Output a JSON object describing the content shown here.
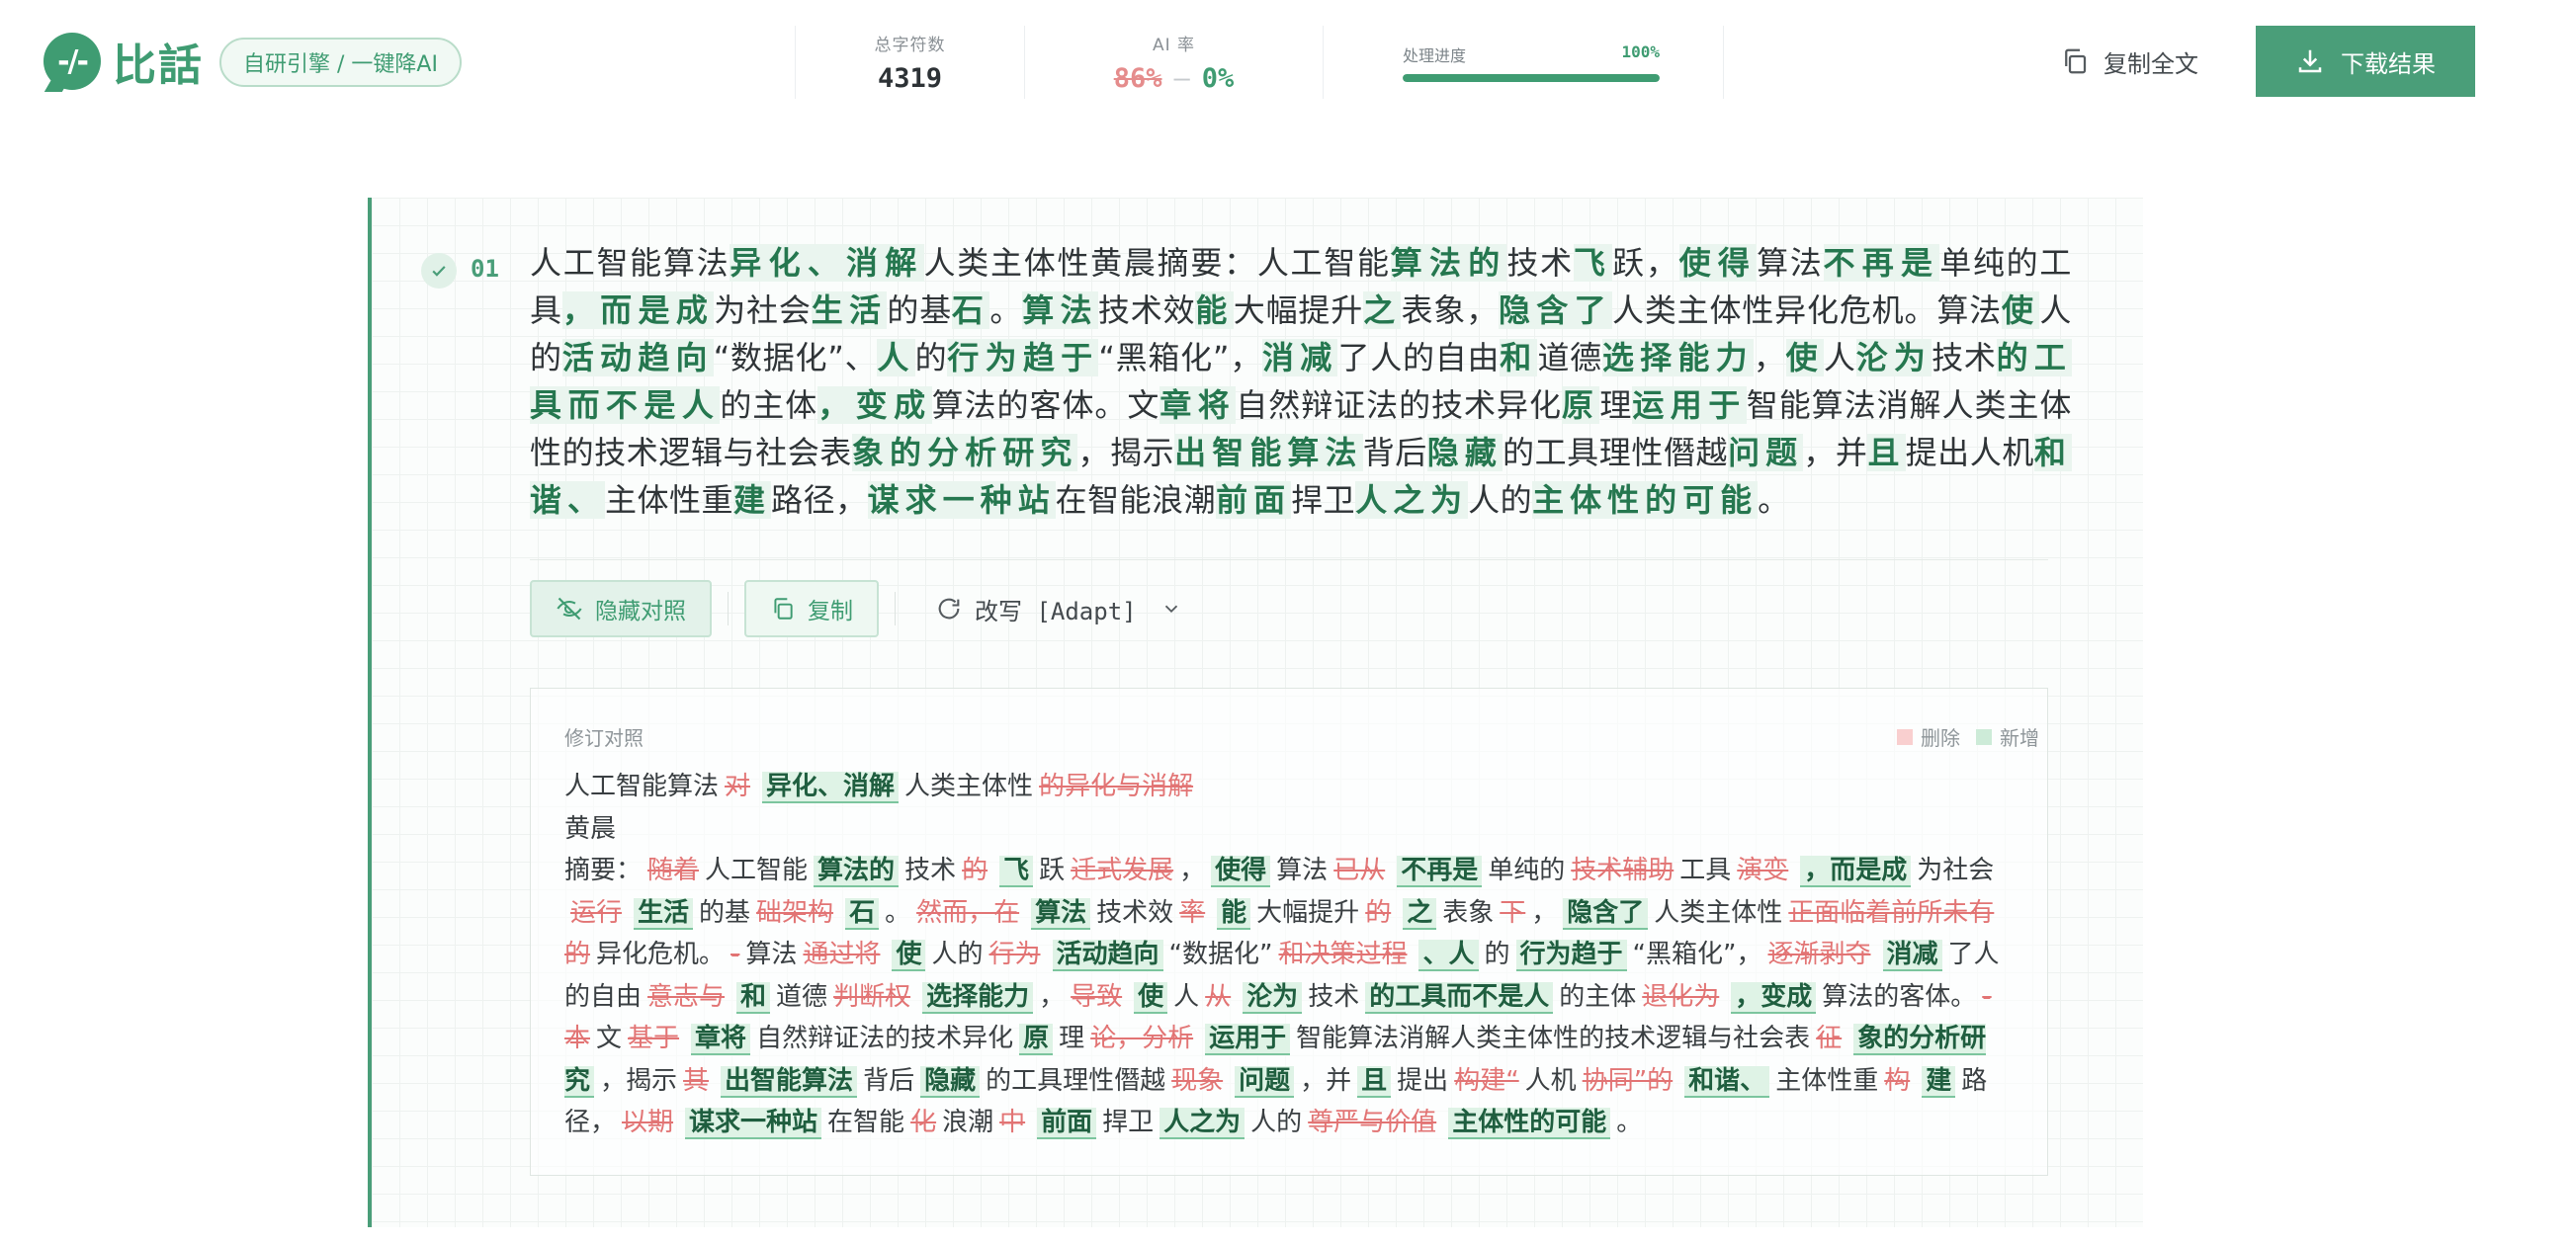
{
  "header": {
    "logo_mark": "-/-",
    "logo_text": "比話",
    "engine_label": "自研引擎 / 一键降AI",
    "stats": {
      "chars_label": "总字符数",
      "chars_value": "4319",
      "ai_label": "AI 率",
      "ai_before": "86%",
      "ai_separator": "—",
      "ai_after": "0%",
      "progress_label": "处理进度",
      "progress_pct_text": "100%",
      "progress_value": 100
    },
    "copy_all_label": "复制全文",
    "download_label": "下载结果",
    "accent_color": "#4a9e79"
  },
  "section": {
    "number": "01",
    "paragraph": [
      {
        "t": "人工智能算法",
        "h": false
      },
      {
        "t": "异化、消解",
        "h": true
      },
      {
        "t": "人类主体性黄晨摘要：人工智能",
        "h": false
      },
      {
        "t": "算法的",
        "h": true
      },
      {
        "t": "技术",
        "h": false
      },
      {
        "t": "飞",
        "h": true
      },
      {
        "t": "跃，",
        "h": false
      },
      {
        "t": "使得",
        "h": true
      },
      {
        "t": "算法",
        "h": false
      },
      {
        "t": "不再是",
        "h": true
      },
      {
        "t": "单纯的工具",
        "h": false
      },
      {
        "t": "，而是成",
        "h": true
      },
      {
        "t": "为社会",
        "h": false
      },
      {
        "t": "生活",
        "h": true
      },
      {
        "t": "的基",
        "h": false
      },
      {
        "t": "石",
        "h": true
      },
      {
        "t": "。",
        "h": false
      },
      {
        "t": "算法",
        "h": true
      },
      {
        "t": "技术效",
        "h": false
      },
      {
        "t": "能",
        "h": true
      },
      {
        "t": "大幅提升",
        "h": false
      },
      {
        "t": "之",
        "h": true
      },
      {
        "t": "表象，",
        "h": false
      },
      {
        "t": "隐含了",
        "h": true
      },
      {
        "t": "人类主体性异化危机。算法",
        "h": false
      },
      {
        "t": "使",
        "h": true
      },
      {
        "t": "人的",
        "h": false
      },
      {
        "t": "活动趋向",
        "h": true
      },
      {
        "t": "“数据化”、",
        "h": false
      },
      {
        "t": "人",
        "h": true
      },
      {
        "t": "的",
        "h": false
      },
      {
        "t": "行为趋于",
        "h": true
      },
      {
        "t": "“黑箱化”，",
        "h": false
      },
      {
        "t": "消减",
        "h": true
      },
      {
        "t": "了人的自由",
        "h": false
      },
      {
        "t": "和",
        "h": true
      },
      {
        "t": "道德",
        "h": false
      },
      {
        "t": "选择能力",
        "h": true
      },
      {
        "t": "，",
        "h": false
      },
      {
        "t": "使",
        "h": true
      },
      {
        "t": "人",
        "h": false
      },
      {
        "t": "沦为",
        "h": true
      },
      {
        "t": "技术",
        "h": false
      },
      {
        "t": "的工具而不是人",
        "h": true
      },
      {
        "t": "的主体",
        "h": false
      },
      {
        "t": "，变成",
        "h": true
      },
      {
        "t": "算法的客体。文",
        "h": false
      },
      {
        "t": "章将",
        "h": true
      },
      {
        "t": "自然辩证法的技术异化",
        "h": false
      },
      {
        "t": "原",
        "h": true
      },
      {
        "t": "理",
        "h": false
      },
      {
        "t": "运用于",
        "h": true
      },
      {
        "t": "智能算法消解人类主体性的技术逻辑与社会表",
        "h": false
      },
      {
        "t": "象的分析研究",
        "h": true
      },
      {
        "t": "，揭示",
        "h": false
      },
      {
        "t": "出智能算法",
        "h": true
      },
      {
        "t": "背后",
        "h": false
      },
      {
        "t": "隐藏",
        "h": true
      },
      {
        "t": "的工具理性僭越",
        "h": false
      },
      {
        "t": "问题",
        "h": true
      },
      {
        "t": "，并",
        "h": false
      },
      {
        "t": "且",
        "h": true
      },
      {
        "t": "提出人机",
        "h": false
      },
      {
        "t": "和谐、",
        "h": true
      },
      {
        "t": "主体性重",
        "h": false
      },
      {
        "t": "建",
        "h": true
      },
      {
        "t": "路径，",
        "h": false
      },
      {
        "t": "谋求一种站",
        "h": true
      },
      {
        "t": "在智能浪潮",
        "h": false
      },
      {
        "t": "前面",
        "h": true
      },
      {
        "t": "捍卫",
        "h": false
      },
      {
        "t": "人之为",
        "h": true
      },
      {
        "t": "人的",
        "h": false
      },
      {
        "t": "主体性的可能",
        "h": true
      },
      {
        "t": "。",
        "h": false
      }
    ],
    "actions": {
      "hide_compare_label": "隐藏对照",
      "copy_label": "复制",
      "rewrite_label": "改写 [Adapt]"
    },
    "diff": {
      "title": "修订对照",
      "legend_delete": "删除",
      "legend_add": "新增",
      "lines": [
        [
          {
            "k": "s",
            "t": "人工智能算法"
          },
          {
            "k": "d",
            "t": "对"
          },
          {
            "k": "a",
            "t": "异化、消解"
          },
          {
            "k": "s",
            "t": "人类主体性"
          },
          {
            "k": "d",
            "t": "的异化与消解"
          }
        ],
        [
          {
            "k": "s",
            "t": "黄晨"
          }
        ],
        [
          {
            "k": "s",
            "t": "摘要："
          },
          {
            "k": "d",
            "t": "随着"
          },
          {
            "k": "s",
            "t": "人工智能"
          },
          {
            "k": "a",
            "t": "算法的"
          },
          {
            "k": "s",
            "t": "技术"
          },
          {
            "k": "d",
            "t": "的"
          },
          {
            "k": "a",
            "t": "飞"
          },
          {
            "k": "s",
            "t": "跃"
          },
          {
            "k": "d",
            "t": "迁式发展"
          },
          {
            "k": "s",
            "t": "，"
          },
          {
            "k": "a",
            "t": "使得"
          },
          {
            "k": "s",
            "t": "算法"
          },
          {
            "k": "d",
            "t": "已从"
          },
          {
            "k": "a",
            "t": "不再是"
          },
          {
            "k": "s",
            "t": "单纯的"
          },
          {
            "k": "d",
            "t": "技术辅助"
          },
          {
            "k": "s",
            "t": "工具"
          },
          {
            "k": "d",
            "t": "演变"
          },
          {
            "k": "a",
            "t": "，而是成"
          },
          {
            "k": "s",
            "t": "为社会"
          },
          {
            "k": "d",
            "t": "运行"
          },
          {
            "k": "a",
            "t": "生活"
          },
          {
            "k": "s",
            "t": "的基"
          },
          {
            "k": "d",
            "t": "础架构"
          },
          {
            "k": "a",
            "t": "石"
          },
          {
            "k": "s",
            "t": "。"
          },
          {
            "k": "d",
            "t": "然而，在"
          },
          {
            "k": "a",
            "t": "算法"
          },
          {
            "k": "s",
            "t": "技术效"
          },
          {
            "k": "d",
            "t": "率"
          },
          {
            "k": "a",
            "t": "能"
          },
          {
            "k": "s",
            "t": "大幅提升"
          },
          {
            "k": "d",
            "t": "的"
          },
          {
            "k": "a",
            "t": "之"
          },
          {
            "k": "s",
            "t": "表象"
          },
          {
            "k": "d",
            "t": "下"
          },
          {
            "k": "s",
            "t": "，"
          },
          {
            "k": "a",
            "t": "隐含了"
          },
          {
            "k": "s",
            "t": "人类主体性"
          },
          {
            "k": "d",
            "t": "正面临着前所未有的"
          },
          {
            "k": "s",
            "t": "异化危机。"
          },
          {
            "k": "d",
            "t": "-"
          },
          {
            "k": "s",
            "t": "算法"
          },
          {
            "k": "d",
            "t": "通过将"
          },
          {
            "k": "a",
            "t": "使"
          },
          {
            "k": "s",
            "t": "人的"
          },
          {
            "k": "d",
            "t": "行为"
          },
          {
            "k": "a",
            "t": "活动趋向"
          },
          {
            "k": "s",
            "t": "“数据化”"
          },
          {
            "k": "d",
            "t": "和决策过程"
          },
          {
            "k": "a",
            "t": "、人"
          },
          {
            "k": "s",
            "t": "的"
          },
          {
            "k": "a",
            "t": "行为趋于"
          },
          {
            "k": "s",
            "t": "“黑箱化”，"
          },
          {
            "k": "d",
            "t": "逐渐剥夺"
          },
          {
            "k": "a",
            "t": "消减"
          },
          {
            "k": "s",
            "t": "了人的自由"
          },
          {
            "k": "d",
            "t": "意志与"
          },
          {
            "k": "a",
            "t": "和"
          },
          {
            "k": "s",
            "t": "道德"
          },
          {
            "k": "d",
            "t": "判断权"
          },
          {
            "k": "a",
            "t": "选择能力"
          },
          {
            "k": "s",
            "t": "，"
          },
          {
            "k": "d",
            "t": "导致"
          },
          {
            "k": "a",
            "t": "使"
          },
          {
            "k": "s",
            "t": "人"
          },
          {
            "k": "d",
            "t": "从"
          },
          {
            "k": "a",
            "t": "沦为"
          },
          {
            "k": "s",
            "t": "技术"
          },
          {
            "k": "a",
            "t": "的工具而不是人"
          },
          {
            "k": "s",
            "t": "的主体"
          },
          {
            "k": "d",
            "t": "退化为"
          },
          {
            "k": "a",
            "t": "，变成"
          },
          {
            "k": "s",
            "t": "算法的客体。"
          },
          {
            "k": "d",
            "t": "-本"
          },
          {
            "k": "s",
            "t": "文"
          },
          {
            "k": "d",
            "t": "基于"
          },
          {
            "k": "a",
            "t": "章将"
          },
          {
            "k": "s",
            "t": "自然辩证法的技术异化"
          },
          {
            "k": "a",
            "t": "原"
          },
          {
            "k": "s",
            "t": "理"
          },
          {
            "k": "d",
            "t": "论，分析"
          },
          {
            "k": "a",
            "t": "运用于"
          },
          {
            "k": "s",
            "t": "智能算法消解人类主体性的技术逻辑与社会表"
          },
          {
            "k": "d",
            "t": "征"
          },
          {
            "k": "a",
            "t": "象的分析研究"
          },
          {
            "k": "s",
            "t": "，揭示"
          },
          {
            "k": "d",
            "t": "其"
          },
          {
            "k": "a",
            "t": "出智能算法"
          },
          {
            "k": "s",
            "t": "背后"
          },
          {
            "k": "a",
            "t": "隐藏"
          },
          {
            "k": "s",
            "t": "的工具理性僭越"
          },
          {
            "k": "d",
            "t": "现象"
          },
          {
            "k": "a",
            "t": "问题"
          },
          {
            "k": "s",
            "t": "，并"
          },
          {
            "k": "a",
            "t": "且"
          },
          {
            "k": "s",
            "t": "提出"
          },
          {
            "k": "d",
            "t": "构建“"
          },
          {
            "k": "s",
            "t": "人机"
          },
          {
            "k": "d",
            "t": "协同”的"
          },
          {
            "k": "a",
            "t": "和谐、"
          },
          {
            "k": "s",
            "t": "主体性重"
          },
          {
            "k": "d",
            "t": "构"
          },
          {
            "k": "a",
            "t": "建"
          },
          {
            "k": "s",
            "t": "路径，"
          },
          {
            "k": "d",
            "t": "以期"
          },
          {
            "k": "a",
            "t": "谋求一种站"
          },
          {
            "k": "s",
            "t": "在智能"
          },
          {
            "k": "d",
            "t": "化"
          },
          {
            "k": "s",
            "t": "浪潮"
          },
          {
            "k": "d",
            "t": "中"
          },
          {
            "k": "a",
            "t": "前面"
          },
          {
            "k": "s",
            "t": "捍卫"
          },
          {
            "k": "a",
            "t": "人之为"
          },
          {
            "k": "s",
            "t": "人的"
          },
          {
            "k": "d",
            "t": "尊严与价值"
          },
          {
            "k": "a",
            "t": "主体性的可能"
          },
          {
            "k": "s",
            "t": "。"
          }
        ]
      ]
    }
  }
}
